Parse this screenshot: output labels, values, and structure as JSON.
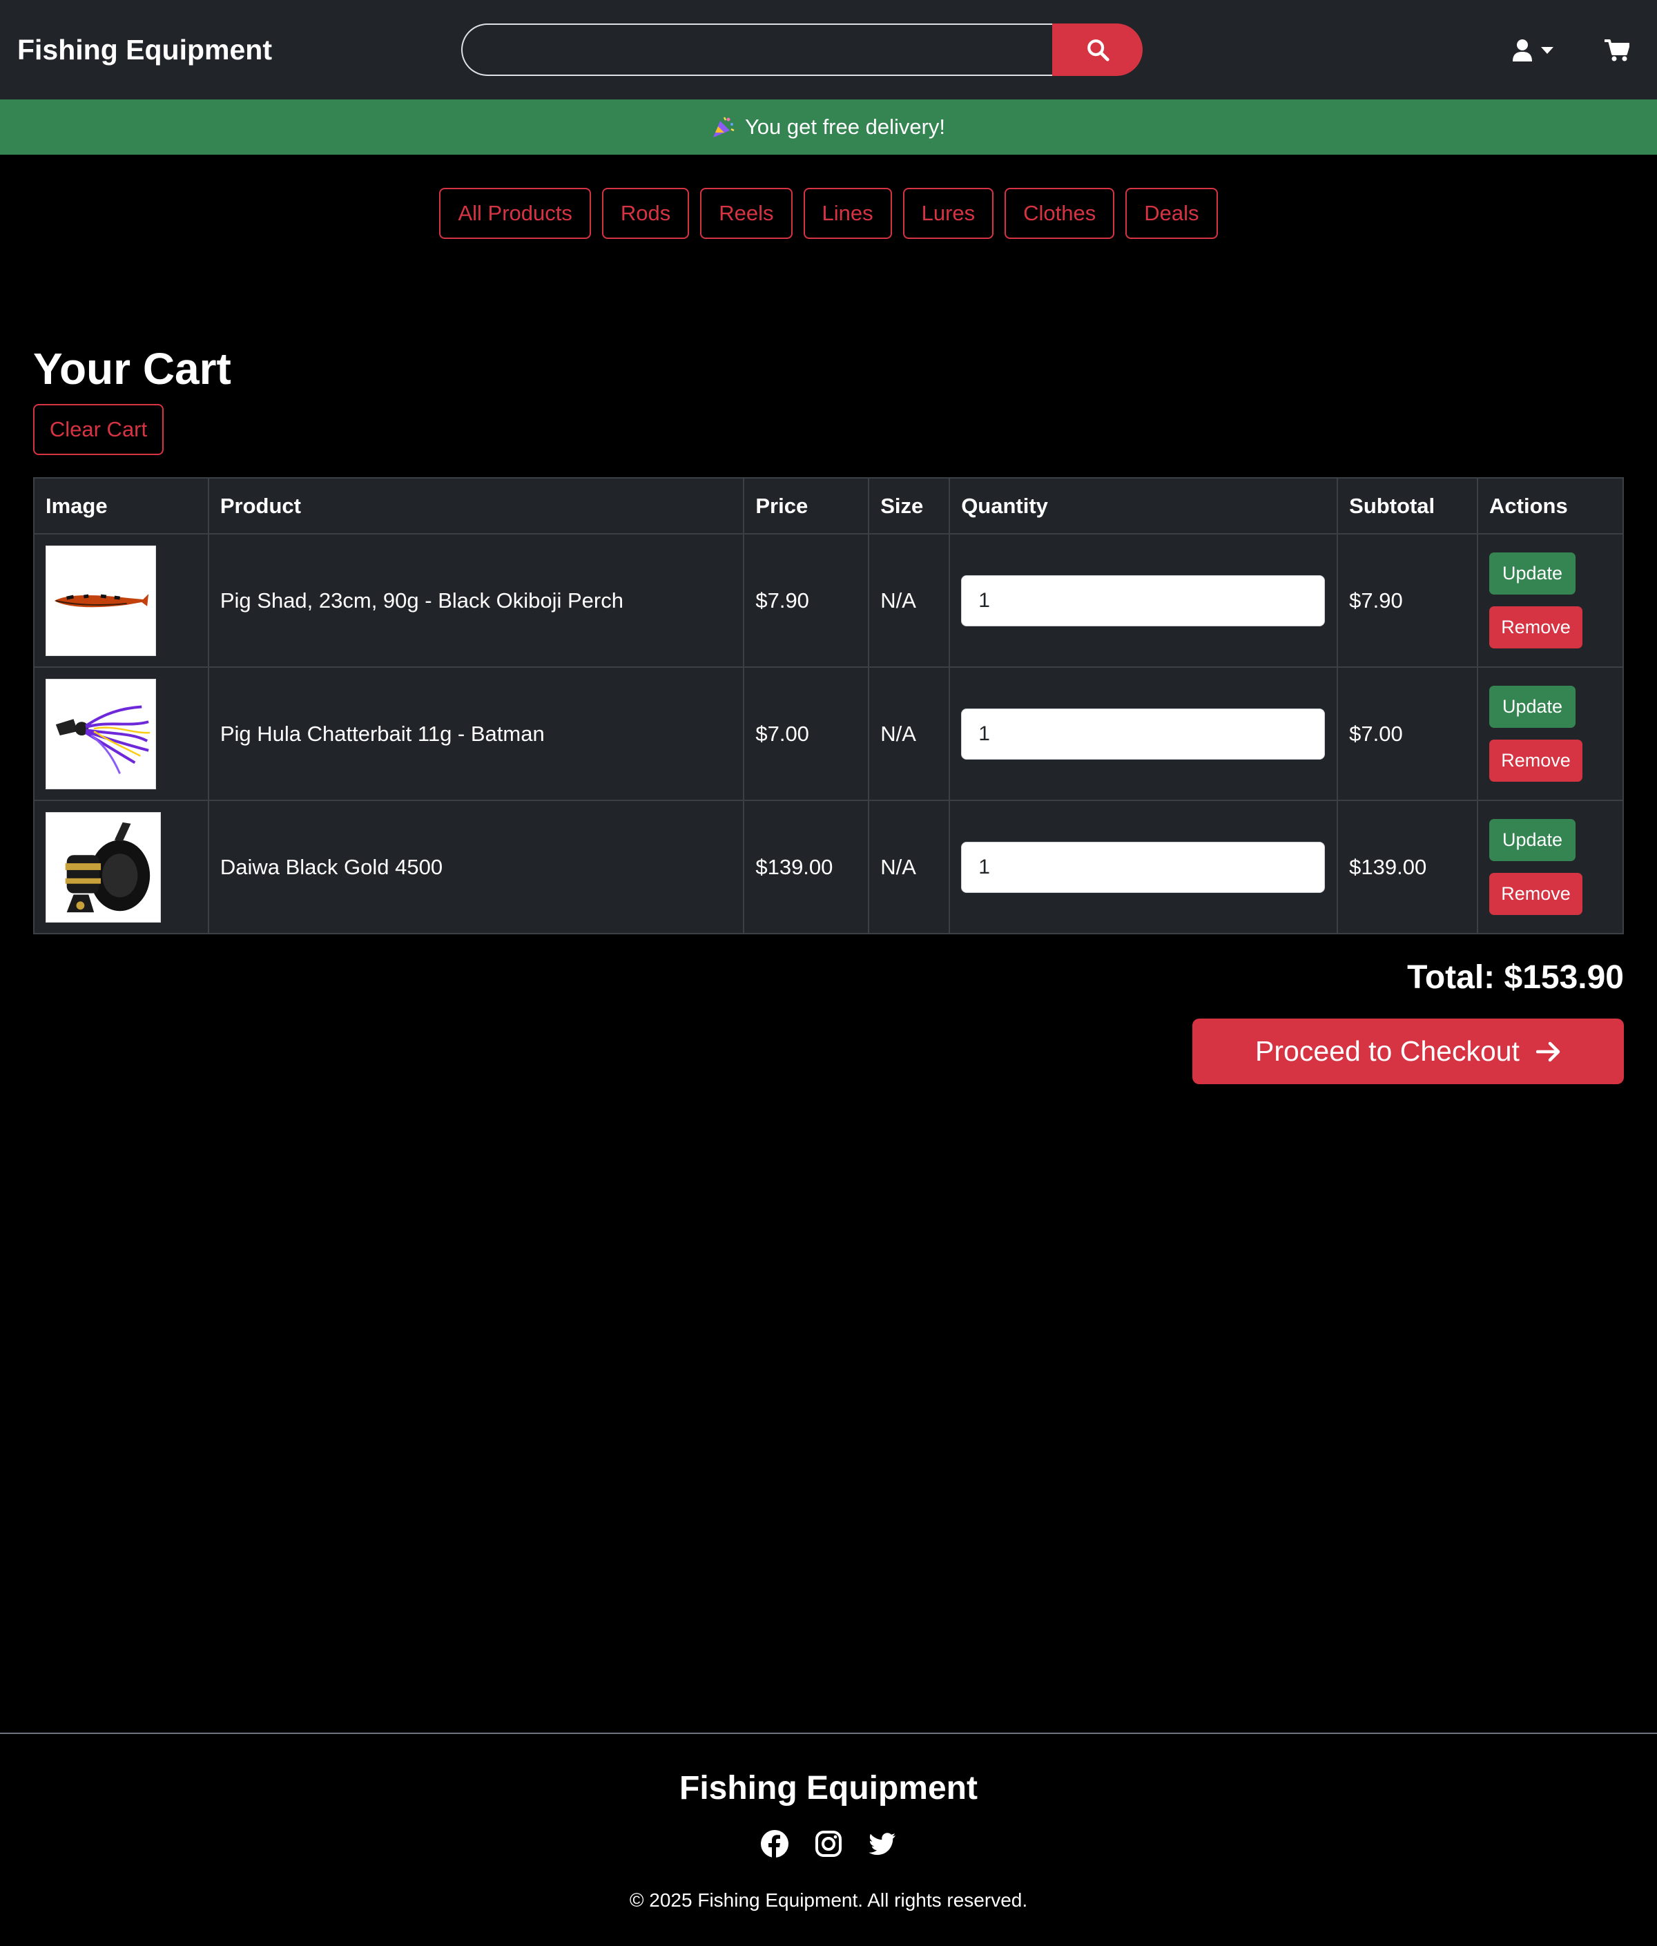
{
  "navbar": {
    "brand": "Fishing Equipment",
    "search": {
      "placeholder": "",
      "value": ""
    },
    "icons": {
      "search": "search-icon",
      "user": "user-icon",
      "dropdown": "caret-down-icon",
      "cart": "cart-icon"
    }
  },
  "banner": {
    "icon": "party-popper-icon",
    "text": "You get free delivery!"
  },
  "categories": [
    "All Products",
    "Rods",
    "Reels",
    "Lines",
    "Lures",
    "Clothes",
    "Deals"
  ],
  "cart": {
    "title": "Your Cart",
    "clear_label": "Clear Cart",
    "columns": [
      "Image",
      "Product",
      "Price",
      "Size",
      "Quantity",
      "Subtotal",
      "Actions"
    ],
    "rows": [
      {
        "product": "Pig Shad, 23cm, 90g - Black Okiboji Perch",
        "price": "$7.90",
        "size": "N/A",
        "quantity": "1",
        "subtotal": "$7.90",
        "update_label": "Update",
        "remove_label": "Remove"
      },
      {
        "product": "Pig Hula Chatterbait 11g - Batman",
        "price": "$7.00",
        "size": "N/A",
        "quantity": "1",
        "subtotal": "$7.00",
        "update_label": "Update",
        "remove_label": "Remove"
      },
      {
        "product": "Daiwa Black Gold 4500",
        "price": "$139.00",
        "size": "N/A",
        "quantity": "1",
        "subtotal": "$139.00",
        "update_label": "Update",
        "remove_label": "Remove"
      }
    ],
    "total": "Total: $153.90",
    "checkout_label": "Proceed to Checkout"
  },
  "footer": {
    "brand": "Fishing Equipment",
    "social": [
      "facebook-icon",
      "instagram-icon",
      "twitter-icon"
    ],
    "copyright": "© 2025 Fishing Equipment. All rights reserved."
  },
  "colors": {
    "navbar": "#212529",
    "banner": "#358553",
    "accent": "#d63343",
    "success": "#358553"
  }
}
